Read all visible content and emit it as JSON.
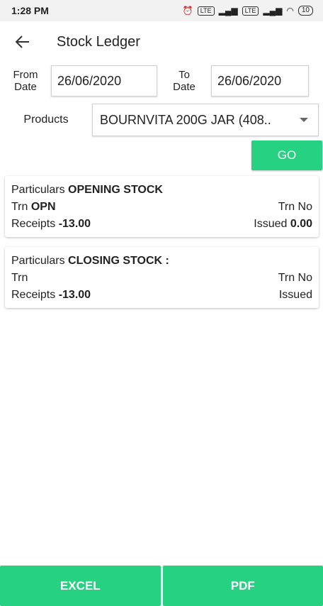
{
  "status": {
    "time": "1:28 PM",
    "battery": "10"
  },
  "header": {
    "title": "Stock Ledger"
  },
  "filters": {
    "from_label_1": "From",
    "from_label_2": "Date",
    "from_value": "26/06/2020",
    "to_label_1": "To",
    "to_label_2": "Date",
    "to_value": "26/06/2020",
    "products_label": "Products",
    "product_value": "BOURNVITA 200G JAR (408..",
    "go_label": "GO"
  },
  "entries": [
    {
      "particulars_label": "Particulars",
      "particulars_value": "OPENING STOCK",
      "trn_label": "Trn",
      "trn_value": "OPN",
      "trn_no_label": "Trn No",
      "trn_no_value": "",
      "receipts_label": "Receipts",
      "receipts_value": "-13.00",
      "issued_label": "Issued",
      "issued_value": "0.00"
    },
    {
      "particulars_label": "Particulars",
      "particulars_value": "CLOSING STOCK :",
      "trn_label": "Trn",
      "trn_value": "",
      "trn_no_label": "Trn No",
      "trn_no_value": "",
      "receipts_label": "Receipts",
      "receipts_value": "-13.00",
      "issued_label": "Issued",
      "issued_value": ""
    }
  ],
  "footer": {
    "excel_label": "EXCEL",
    "pdf_label": "PDF"
  },
  "colors": {
    "accent": "#27d182"
  }
}
